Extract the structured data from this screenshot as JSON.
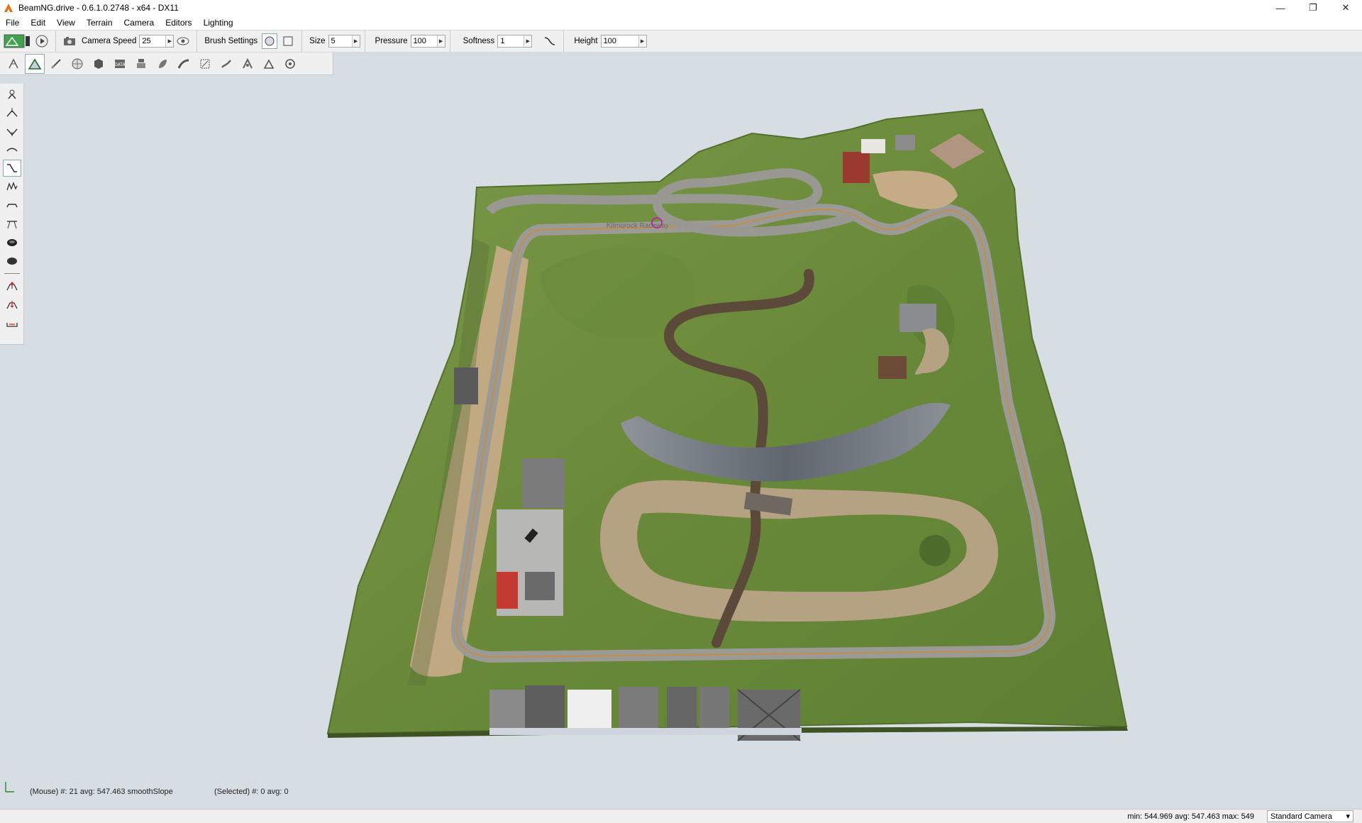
{
  "window": {
    "title": "BeamNG.drive - 0.6.1.0.2748 - x64 - DX11"
  },
  "menu": [
    "File",
    "Edit",
    "View",
    "Terrain",
    "Camera",
    "Editors",
    "Lighting"
  ],
  "toolbar": {
    "camera_speed_label": "Camera Speed",
    "camera_speed_value": "25",
    "brush_settings_label": "Brush Settings",
    "size_label": "Size",
    "size_value": "5",
    "pressure_label": "Pressure",
    "pressure_value": "100",
    "softness_label": "Softness",
    "softness_value": "1",
    "height_label": "Height",
    "height_value": "100"
  },
  "hud": {
    "mouse_text": "(Mouse) #: 21  avg: 547.463 smoothSlope",
    "selected_text": "(Selected) #: 0  avg: 0"
  },
  "viewport": {
    "road_label": "Kilmorock Raceway"
  },
  "status": {
    "stats_text": "min: 544.969  avg: 547.463  max: 549",
    "camera_mode": "Standard Camera"
  },
  "colors": {
    "background": "#d6dde3",
    "grass": "#6f8d3c",
    "road": "#9c9a95",
    "dirt_track": "#b5a283",
    "river": "#6c737a"
  },
  "icons": {
    "app": "beamng-icon",
    "brush_shape_circle": "circle-brush-icon",
    "brush_shape_square": "square-brush-icon"
  }
}
